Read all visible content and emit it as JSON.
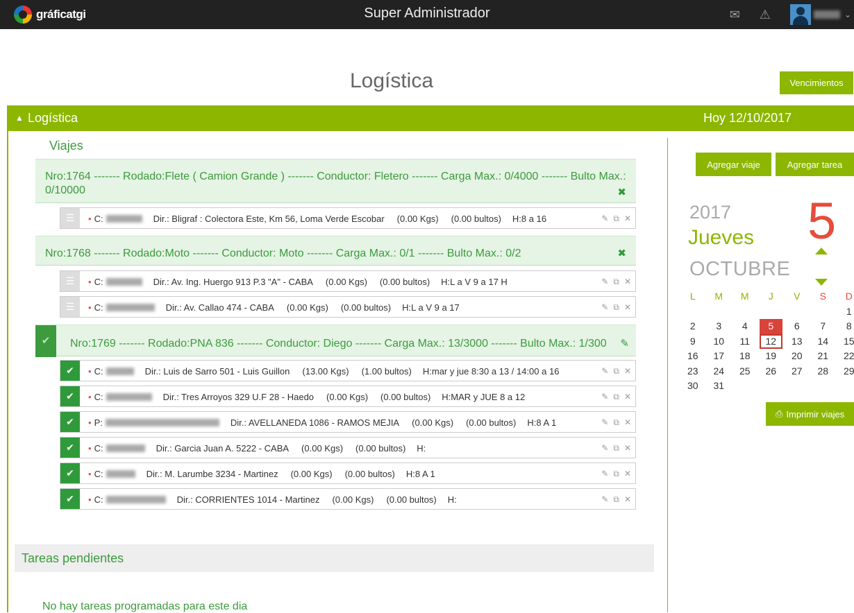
{
  "topbar": {
    "brand": "gráficatgi",
    "title": "Super Administrador",
    "icons": {
      "messages": "envelope-icon",
      "alerts": "warning-icon",
      "user": "user-avatar"
    }
  },
  "page": {
    "title": "Logística",
    "vencimientos_label": "Vencimientos"
  },
  "panel": {
    "title": "Logística",
    "today": "Hoy 12/10/2017",
    "section_title": "Viajes"
  },
  "trips": [
    {
      "text": "Nro:1764 ------- Rodado:Flete ( Camion Grande ) ------- Conductor: Fletero ------- Carga Max.: 0/4000 ------- Bulto Max.: 0/10000",
      "status": "pending"
    },
    {
      "text": "Nro:1768 ------- Rodado:Moto ------- Conductor: Moto ------- Carga Max.: 0/1 ------- Bulto Max.: 0/2",
      "status": "pending"
    },
    {
      "text": "Nro:1769 ------- Rodado:PNA 836 ------- Conductor: Diego ------- Carga Max.: 13/3000 ------- Bulto Max.: 1/300",
      "status": "done"
    }
  ],
  "stops": [
    {
      "prefix": "C:",
      "dir": "Dir.: Bligraf : Colectora Este, Km 56, Loma Verde Escobar",
      "kgs": "(0.00 Kgs)",
      "bultos": "(0.00 bultos)",
      "hours": "H:8 a 16"
    },
    {
      "prefix": "C:",
      "dir": "Dir.: Av. Ing. Huergo 913 P.3 \"A\" - CABA",
      "kgs": "(0.00 Kgs)",
      "bultos": "(0.00 bultos)",
      "hours": "H:L a V 9 a 17 H"
    },
    {
      "prefix": "C:",
      "dir": "Dir.: Av. Callao 474 - CABA",
      "kgs": "(0.00 Kgs)",
      "bultos": "(0.00 bultos)",
      "hours": "H:L a V 9 a 17"
    },
    {
      "prefix": "C:",
      "dir": "Dir.: Luis de Sarro 501 - Luis Guillon",
      "kgs": "(13.00 Kgs)",
      "bultos": "(1.00 bultos)",
      "hours": "H:mar y jue 8:30 a 13 / 14:00 a 16"
    },
    {
      "prefix": "C:",
      "dir": "Dir.: Tres Arroyos 329 U.F 28 - Haedo",
      "kgs": "(0.00 Kgs)",
      "bultos": "(0.00 bultos)",
      "hours": "H:MAR y JUE 8 a 12"
    },
    {
      "prefix": "P:",
      "dir": "Dir.: AVELLANEDA 1086 - RAMOS MEJIA",
      "kgs": "(0.00 Kgs)",
      "bultos": "(0.00 bultos)",
      "hours": "H:8 A 1"
    },
    {
      "prefix": "C:",
      "dir": "Dir.: Garcia Juan A. 5222 - CABA",
      "kgs": "(0.00 Kgs)",
      "bultos": "(0.00 bultos)",
      "hours": "H:"
    },
    {
      "prefix": "C:",
      "dir": "Dir.: M. Larumbe 3234 - Martinez",
      "kgs": "(0.00 Kgs)",
      "bultos": "(0.00 bultos)",
      "hours": "H:8 A 1"
    },
    {
      "prefix": "C:",
      "dir": "Dir.: CORRIENTES 1014 - Martinez",
      "kgs": "(0.00 Kgs)",
      "bultos": "(0.00 bultos)",
      "hours": "H:"
    }
  ],
  "tareas": {
    "title": "Tareas pendientes",
    "empty": "No hay tareas programadas para este dia"
  },
  "sidebar": {
    "add_trip": "Agregar viaje",
    "add_task": "Agregar tarea",
    "print": "Imprimir viajes"
  },
  "calendar": {
    "year": "2017",
    "weekday": "Jueves",
    "month": "OCTUBRE",
    "day": "5",
    "headers": [
      "L",
      "M",
      "M",
      "J",
      "V",
      "S",
      "D"
    ],
    "weeks": [
      [
        "",
        "",
        "",
        "",
        "",
        "",
        "1"
      ],
      [
        "2",
        "3",
        "4",
        "5",
        "6",
        "7",
        "8"
      ],
      [
        "9",
        "10",
        "11",
        "12",
        "13",
        "14",
        "15"
      ],
      [
        "16",
        "17",
        "18",
        "19",
        "20",
        "21",
        "22"
      ],
      [
        "23",
        "24",
        "25",
        "26",
        "27",
        "28",
        "29"
      ],
      [
        "30",
        "31",
        "",
        "",
        "",
        "",
        ""
      ]
    ],
    "selected": "5",
    "today": "12",
    "colors": {
      "accent": "#8cb600",
      "selected": "#d9433a"
    }
  }
}
